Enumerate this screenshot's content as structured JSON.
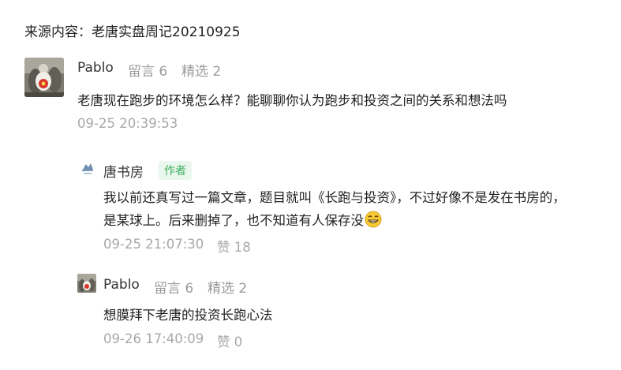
{
  "source_line": "来源内容：老唐实盘周记20210925",
  "comment": {
    "user": "Pablo",
    "replies_label": "留言 6",
    "featured_label": "精选 2",
    "text": "老唐现在跑步的环境怎么样？能聊聊你认为跑步和投资之间的关系和想法吗",
    "time": "09-25 20:39:53"
  },
  "reply1": {
    "user": "唐书房",
    "badge": "作者",
    "line1": "我以前还真写过一篇文章，题目就叫《长跑与投资》，不过好像不是发在书房的，",
    "line2": "是某球上。后来删掉了，也不知道有人保存没",
    "emoji": "grinning-emoji",
    "time": "09-25 21:07:30",
    "likes_label": "赞 18"
  },
  "reply2": {
    "user": "Pablo",
    "replies_label": "留言 6",
    "featured_label": "精选 2",
    "text": "想膜拜下老唐的投资长跑心法",
    "time": "09-26 17:40:09",
    "likes_label": "赞 0"
  },
  "colors": {
    "author_badge_bg": "#eaf7ee",
    "author_badge_text": "#3cae5c",
    "meta_gray": "#9b9b9b"
  }
}
